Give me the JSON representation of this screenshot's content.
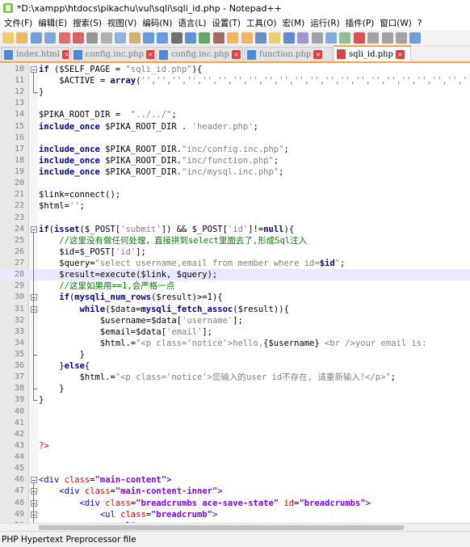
{
  "window": {
    "title": "*D:\\xampp\\htdocs\\pikachu\\vul\\sqli\\sqli_id.php - Notepad++"
  },
  "menu": [
    "文件(F)",
    "编辑(E)",
    "搜索(S)",
    "视图(V)",
    "编码(N)",
    "语言(L)",
    "设置(T)",
    "工具(O)",
    "宏(M)",
    "运行(R)",
    "插件(P)",
    "窗口(W)",
    "?"
  ],
  "toolbar_icons": [
    "new-file-icon",
    "open-file-icon",
    "save-icon",
    "save-all-icon",
    "close-icon",
    "close-all-icon",
    "print-icon",
    "cut-icon",
    "copy-icon",
    "paste-icon",
    "undo-icon",
    "redo-icon",
    "find-icon",
    "replace-icon",
    "zoom-in-icon",
    "zoom-out-icon",
    "sync-v-icon",
    "sync-h-icon",
    "word-wrap-icon",
    "show-all-icon",
    "indent-guide-icon",
    "lang-icon",
    "doc-map-icon",
    "func-list-icon",
    "monitor-icon",
    "record-icon",
    "stop-icon",
    "play-icon",
    "play-multi-icon",
    "save-macro-icon"
  ],
  "tabs": [
    {
      "label": "index.html",
      "active": false
    },
    {
      "label": "config.inc.php",
      "active": false
    },
    {
      "label": "config.inc.php",
      "active": false
    },
    {
      "label": "function.php",
      "active": false
    },
    {
      "label": "sqli_id.php",
      "active": true
    }
  ],
  "code_lines": [
    {
      "n": "10",
      "html": "<span class=\"kw\">if</span> ($SELF_PAGE = <span class=\"str\">\"sqli_id.php\"</span>){",
      "fold": "start"
    },
    {
      "n": "11",
      "html": "    $ACTIVE = <span class=\"kw\">array</span>(<span class=\"str\">'','','','','','','','','','','','','','','','','','','','','','',</span>"
    },
    {
      "n": "12",
      "html": "}",
      "fold": "end"
    },
    {
      "n": "13",
      "html": ""
    },
    {
      "n": "14",
      "html": "$PIKA_ROOT_DIR =  <span class=\"str\">\"../../\"</span>;"
    },
    {
      "n": "15",
      "html": "<span class=\"kw\">include_once</span> $PIKA_ROOT_DIR . <span class=\"str\">'header.php'</span>;"
    },
    {
      "n": "16",
      "html": ""
    },
    {
      "n": "17",
      "html": "<span class=\"kw\">include_once</span> $PIKA_ROOT_DIR.<span class=\"str\">\"inc/config.inc.php\"</span>;"
    },
    {
      "n": "18",
      "html": "<span class=\"kw\">include_once</span> $PIKA_ROOT_DIR.<span class=\"str\">\"inc/function.php\"</span>;"
    },
    {
      "n": "19",
      "html": "<span class=\"kw\">include_once</span> $PIKA_ROOT_DIR.<span class=\"str\">\"inc/mysql.inc.php\"</span>;"
    },
    {
      "n": "20",
      "html": ""
    },
    {
      "n": "21",
      "html": "$link=connect();"
    },
    {
      "n": "22",
      "html": "$html=<span class=\"str\">''</span>;"
    },
    {
      "n": "23",
      "html": ""
    },
    {
      "n": "24",
      "html": "<span class=\"kw\">if</span>(<span class=\"kw\">isset</span>($_POST[<span class=\"str\">'submit'</span>]) &amp;&amp; $_POST[<span class=\"str\">'id'</span>]!=<span class=\"kw\">null</span>){",
      "fold": "start"
    },
    {
      "n": "25",
      "html": "    <span class=\"cm\">//这里没有做任何处理，直接拼到select里面去了,形成Sql注入</span>"
    },
    {
      "n": "26",
      "html": "    $id=$_POST[<span class=\"str\">'id'</span>];"
    },
    {
      "n": "27",
      "html": "    $query=<span class=\"str\">\"select username,email from member where id=</span><span class=\"kw\">$id</span><span class=\"str\">\"</span>;"
    },
    {
      "n": "28",
      "html": "    $result=execute($link, $query);",
      "current": true
    },
    {
      "n": "29",
      "html": "    <span class=\"cm\">//这里如果用==1,会严格一点</span>"
    },
    {
      "n": "30",
      "html": "    <span class=\"kw\">if</span>(<span class=\"kw\">mysqli_num_rows</span>($result)&gt;=1){",
      "fold": "start"
    },
    {
      "n": "31",
      "html": "        <span class=\"kw\">while</span>($data=<span class=\"kw\">mysqli_fetch_assoc</span>($result)){",
      "fold": "start"
    },
    {
      "n": "32",
      "html": "            $username=$data[<span class=\"str\">'username'</span>];"
    },
    {
      "n": "33",
      "html": "            $email=$data[<span class=\"str\">'email'</span>];"
    },
    {
      "n": "34",
      "html": "            $html.=<span class=\"str\">\"&lt;p class='notice'&gt;hello,</span>{$username}<span class=\"str\"> &lt;br /&gt;your email is: </span>"
    },
    {
      "n": "35",
      "html": "        }",
      "fold": "end"
    },
    {
      "n": "36",
      "html": "    }<span class=\"kw\">else</span>{",
      "fold": "mid"
    },
    {
      "n": "37",
      "html": "        $html.=<span class=\"str\">\"&lt;p class='notice'&gt;您输入的user id不存在, 请重新输入!&lt;/p&gt;\"</span>;"
    },
    {
      "n": "38",
      "html": "    }",
      "fold": "end"
    },
    {
      "n": "39",
      "html": "}",
      "fold": "end"
    },
    {
      "n": "40",
      "html": ""
    },
    {
      "n": "41",
      "html": ""
    },
    {
      "n": "42",
      "html": ""
    },
    {
      "n": "43",
      "html": "<span class=\"php\">?&gt;</span>"
    },
    {
      "n": "44",
      "html": ""
    },
    {
      "n": "45",
      "html": ""
    },
    {
      "n": "46",
      "html": "<span class=\"tag\">&lt;div</span> <span class=\"attr\">class</span>=<span class=\"val\">\"main-content\"</span><span class=\"tag\">&gt;</span>",
      "fold": "start"
    },
    {
      "n": "47",
      "html": "    <span class=\"tag\">&lt;div</span> <span class=\"attr\">class</span>=<span class=\"val\">\"main-content-inner\"</span><span class=\"tag\">&gt;</span>",
      "fold": "start"
    },
    {
      "n": "48",
      "html": "        <span class=\"tag\">&lt;div</span> <span class=\"attr\">class</span>=<span class=\"val\">\"breadcrumbs ace-save-state\"</span> <span class=\"attr\">id</span>=<span class=\"val\">\"breadcrumbs\"</span><span class=\"tag\">&gt;</span>",
      "fold": "start"
    },
    {
      "n": "49",
      "html": "            <span class=\"tag\">&lt;ul</span> <span class=\"attr\">class</span>=<span class=\"val\">\"breadcrumb\"</span><span class=\"tag\">&gt;</span>",
      "fold": "start"
    },
    {
      "n": "50",
      "html": "                <span class=\"tag\">&lt;li&gt;</span>"
    }
  ],
  "status": {
    "file_type": "PHP Hypertext Preprocessor file"
  }
}
